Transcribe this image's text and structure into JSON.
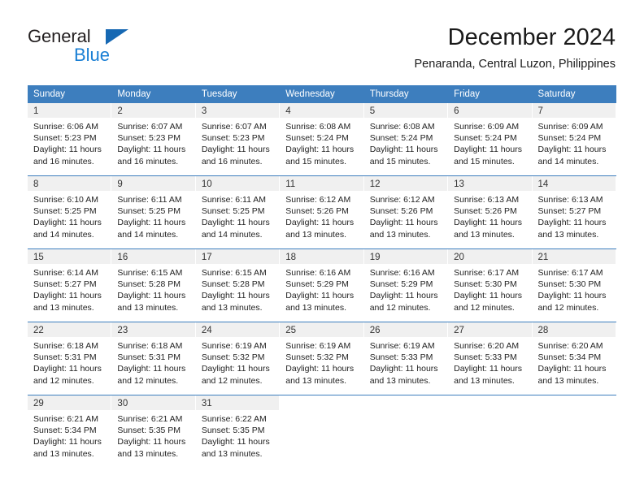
{
  "logo": {
    "text_top": "General",
    "text_bottom": "Blue",
    "triangle_color": "#1668b3",
    "blue_color": "#1a7fd4"
  },
  "header": {
    "title": "December 2024",
    "subtitle": "Penaranda, Central Luzon, Philippines"
  },
  "theme": {
    "header_blue": "#3d7ebe",
    "daynum_band": "#f0f0f0",
    "text": "#1f1f1f"
  },
  "calendar": {
    "weekdays": [
      "Sunday",
      "Monday",
      "Tuesday",
      "Wednesday",
      "Thursday",
      "Friday",
      "Saturday"
    ],
    "weeks": [
      [
        {
          "day": "1",
          "sunrise": "Sunrise: 6:06 AM",
          "sunset": "Sunset: 5:23 PM",
          "daylight_l1": "Daylight: 11 hours",
          "daylight_l2": "and 16 minutes."
        },
        {
          "day": "2",
          "sunrise": "Sunrise: 6:07 AM",
          "sunset": "Sunset: 5:23 PM",
          "daylight_l1": "Daylight: 11 hours",
          "daylight_l2": "and 16 minutes."
        },
        {
          "day": "3",
          "sunrise": "Sunrise: 6:07 AM",
          "sunset": "Sunset: 5:23 PM",
          "daylight_l1": "Daylight: 11 hours",
          "daylight_l2": "and 16 minutes."
        },
        {
          "day": "4",
          "sunrise": "Sunrise: 6:08 AM",
          "sunset": "Sunset: 5:24 PM",
          "daylight_l1": "Daylight: 11 hours",
          "daylight_l2": "and 15 minutes."
        },
        {
          "day": "5",
          "sunrise": "Sunrise: 6:08 AM",
          "sunset": "Sunset: 5:24 PM",
          "daylight_l1": "Daylight: 11 hours",
          "daylight_l2": "and 15 minutes."
        },
        {
          "day": "6",
          "sunrise": "Sunrise: 6:09 AM",
          "sunset": "Sunset: 5:24 PM",
          "daylight_l1": "Daylight: 11 hours",
          "daylight_l2": "and 15 minutes."
        },
        {
          "day": "7",
          "sunrise": "Sunrise: 6:09 AM",
          "sunset": "Sunset: 5:24 PM",
          "daylight_l1": "Daylight: 11 hours",
          "daylight_l2": "and 14 minutes."
        }
      ],
      [
        {
          "day": "8",
          "sunrise": "Sunrise: 6:10 AM",
          "sunset": "Sunset: 5:25 PM",
          "daylight_l1": "Daylight: 11 hours",
          "daylight_l2": "and 14 minutes."
        },
        {
          "day": "9",
          "sunrise": "Sunrise: 6:11 AM",
          "sunset": "Sunset: 5:25 PM",
          "daylight_l1": "Daylight: 11 hours",
          "daylight_l2": "and 14 minutes."
        },
        {
          "day": "10",
          "sunrise": "Sunrise: 6:11 AM",
          "sunset": "Sunset: 5:25 PM",
          "daylight_l1": "Daylight: 11 hours",
          "daylight_l2": "and 14 minutes."
        },
        {
          "day": "11",
          "sunrise": "Sunrise: 6:12 AM",
          "sunset": "Sunset: 5:26 PM",
          "daylight_l1": "Daylight: 11 hours",
          "daylight_l2": "and 13 minutes."
        },
        {
          "day": "12",
          "sunrise": "Sunrise: 6:12 AM",
          "sunset": "Sunset: 5:26 PM",
          "daylight_l1": "Daylight: 11 hours",
          "daylight_l2": "and 13 minutes."
        },
        {
          "day": "13",
          "sunrise": "Sunrise: 6:13 AM",
          "sunset": "Sunset: 5:26 PM",
          "daylight_l1": "Daylight: 11 hours",
          "daylight_l2": "and 13 minutes."
        },
        {
          "day": "14",
          "sunrise": "Sunrise: 6:13 AM",
          "sunset": "Sunset: 5:27 PM",
          "daylight_l1": "Daylight: 11 hours",
          "daylight_l2": "and 13 minutes."
        }
      ],
      [
        {
          "day": "15",
          "sunrise": "Sunrise: 6:14 AM",
          "sunset": "Sunset: 5:27 PM",
          "daylight_l1": "Daylight: 11 hours",
          "daylight_l2": "and 13 minutes."
        },
        {
          "day": "16",
          "sunrise": "Sunrise: 6:15 AM",
          "sunset": "Sunset: 5:28 PM",
          "daylight_l1": "Daylight: 11 hours",
          "daylight_l2": "and 13 minutes."
        },
        {
          "day": "17",
          "sunrise": "Sunrise: 6:15 AM",
          "sunset": "Sunset: 5:28 PM",
          "daylight_l1": "Daylight: 11 hours",
          "daylight_l2": "and 13 minutes."
        },
        {
          "day": "18",
          "sunrise": "Sunrise: 6:16 AM",
          "sunset": "Sunset: 5:29 PM",
          "daylight_l1": "Daylight: 11 hours",
          "daylight_l2": "and 13 minutes."
        },
        {
          "day": "19",
          "sunrise": "Sunrise: 6:16 AM",
          "sunset": "Sunset: 5:29 PM",
          "daylight_l1": "Daylight: 11 hours",
          "daylight_l2": "and 12 minutes."
        },
        {
          "day": "20",
          "sunrise": "Sunrise: 6:17 AM",
          "sunset": "Sunset: 5:30 PM",
          "daylight_l1": "Daylight: 11 hours",
          "daylight_l2": "and 12 minutes."
        },
        {
          "day": "21",
          "sunrise": "Sunrise: 6:17 AM",
          "sunset": "Sunset: 5:30 PM",
          "daylight_l1": "Daylight: 11 hours",
          "daylight_l2": "and 12 minutes."
        }
      ],
      [
        {
          "day": "22",
          "sunrise": "Sunrise: 6:18 AM",
          "sunset": "Sunset: 5:31 PM",
          "daylight_l1": "Daylight: 11 hours",
          "daylight_l2": "and 12 minutes."
        },
        {
          "day": "23",
          "sunrise": "Sunrise: 6:18 AM",
          "sunset": "Sunset: 5:31 PM",
          "daylight_l1": "Daylight: 11 hours",
          "daylight_l2": "and 12 minutes."
        },
        {
          "day": "24",
          "sunrise": "Sunrise: 6:19 AM",
          "sunset": "Sunset: 5:32 PM",
          "daylight_l1": "Daylight: 11 hours",
          "daylight_l2": "and 12 minutes."
        },
        {
          "day": "25",
          "sunrise": "Sunrise: 6:19 AM",
          "sunset": "Sunset: 5:32 PM",
          "daylight_l1": "Daylight: 11 hours",
          "daylight_l2": "and 13 minutes."
        },
        {
          "day": "26",
          "sunrise": "Sunrise: 6:19 AM",
          "sunset": "Sunset: 5:33 PM",
          "daylight_l1": "Daylight: 11 hours",
          "daylight_l2": "and 13 minutes."
        },
        {
          "day": "27",
          "sunrise": "Sunrise: 6:20 AM",
          "sunset": "Sunset: 5:33 PM",
          "daylight_l1": "Daylight: 11 hours",
          "daylight_l2": "and 13 minutes."
        },
        {
          "day": "28",
          "sunrise": "Sunrise: 6:20 AM",
          "sunset": "Sunset: 5:34 PM",
          "daylight_l1": "Daylight: 11 hours",
          "daylight_l2": "and 13 minutes."
        }
      ],
      [
        {
          "day": "29",
          "sunrise": "Sunrise: 6:21 AM",
          "sunset": "Sunset: 5:34 PM",
          "daylight_l1": "Daylight: 11 hours",
          "daylight_l2": "and 13 minutes."
        },
        {
          "day": "30",
          "sunrise": "Sunrise: 6:21 AM",
          "sunset": "Sunset: 5:35 PM",
          "daylight_l1": "Daylight: 11 hours",
          "daylight_l2": "and 13 minutes."
        },
        {
          "day": "31",
          "sunrise": "Sunrise: 6:22 AM",
          "sunset": "Sunset: 5:35 PM",
          "daylight_l1": "Daylight: 11 hours",
          "daylight_l2": "and 13 minutes."
        },
        {
          "day": "",
          "sunrise": "",
          "sunset": "",
          "daylight_l1": "",
          "daylight_l2": ""
        },
        {
          "day": "",
          "sunrise": "",
          "sunset": "",
          "daylight_l1": "",
          "daylight_l2": ""
        },
        {
          "day": "",
          "sunrise": "",
          "sunset": "",
          "daylight_l1": "",
          "daylight_l2": ""
        },
        {
          "day": "",
          "sunrise": "",
          "sunset": "",
          "daylight_l1": "",
          "daylight_l2": ""
        }
      ]
    ]
  }
}
